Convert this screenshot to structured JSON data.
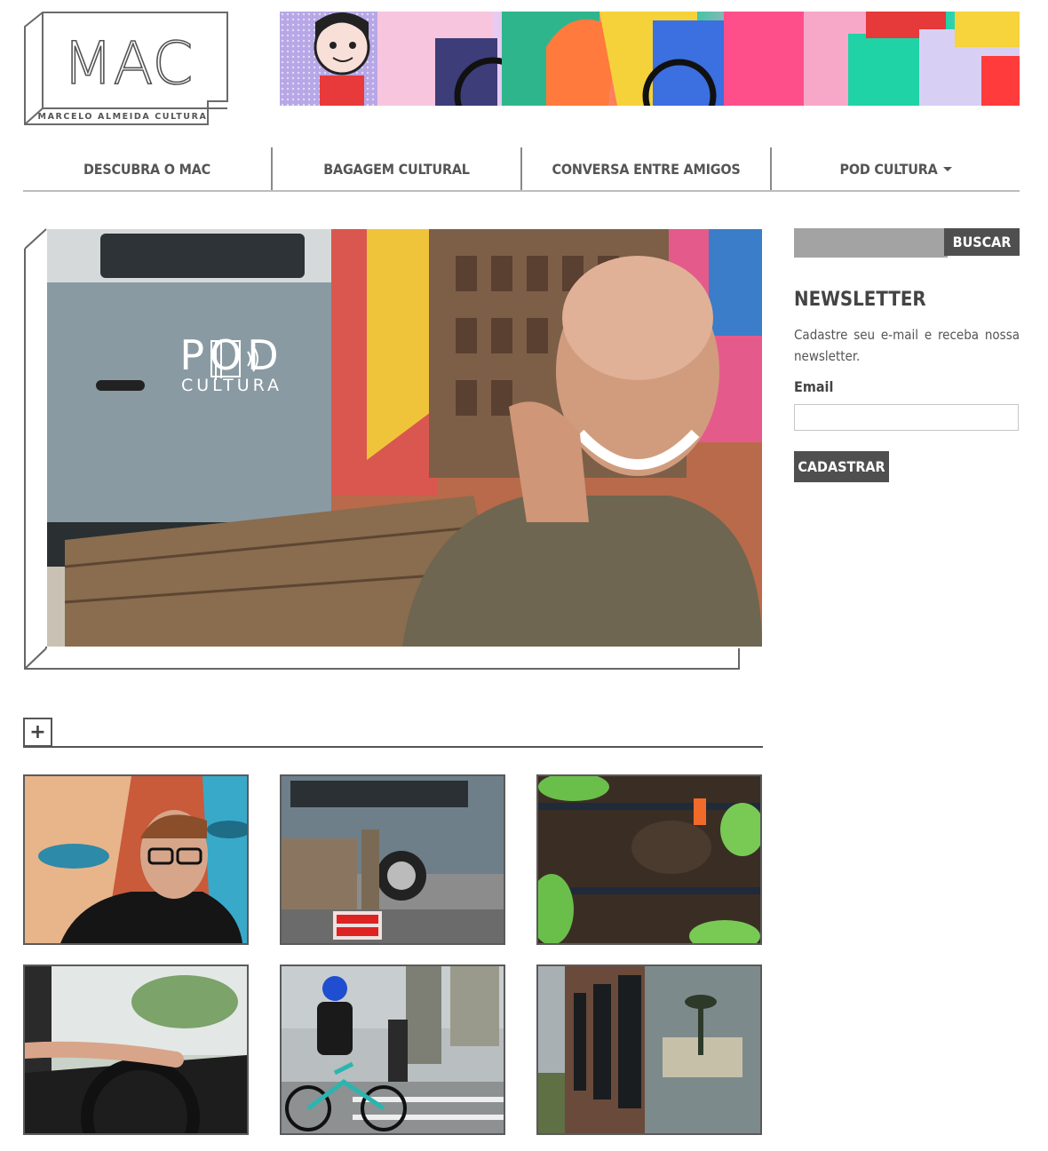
{
  "logo": {
    "mark": "MAC",
    "tagline": "MARCELO ALMEIDA CULTURA"
  },
  "nav": {
    "items": [
      {
        "label": "DESCUBRA O MAC"
      },
      {
        "label": "BAGAGEM CULTURAL"
      },
      {
        "label": "CONVERSA ENTRE AMIGOS"
      },
      {
        "label": "POD CULTURA"
      }
    ]
  },
  "hero": {
    "logo_big": "POD",
    "logo_small": "CULTURA"
  },
  "search": {
    "button_label": "BUSCAR",
    "value": ""
  },
  "newsletter": {
    "title": "NEWSLETTER",
    "description": "Cadastre seu e-mail e receba nossa newsletter.",
    "email_label": "Email",
    "email_value": "",
    "submit_label": "CADASTRAR"
  },
  "more": {
    "icon": "plus-icon"
  },
  "thumbnails": [
    {
      "icon": "portrait-graffiti"
    },
    {
      "icon": "van-bench"
    },
    {
      "icon": "garden-soil"
    },
    {
      "icon": "steering-wheel"
    },
    {
      "icon": "cyclist-street"
    },
    {
      "icon": "train-window"
    }
  ]
}
